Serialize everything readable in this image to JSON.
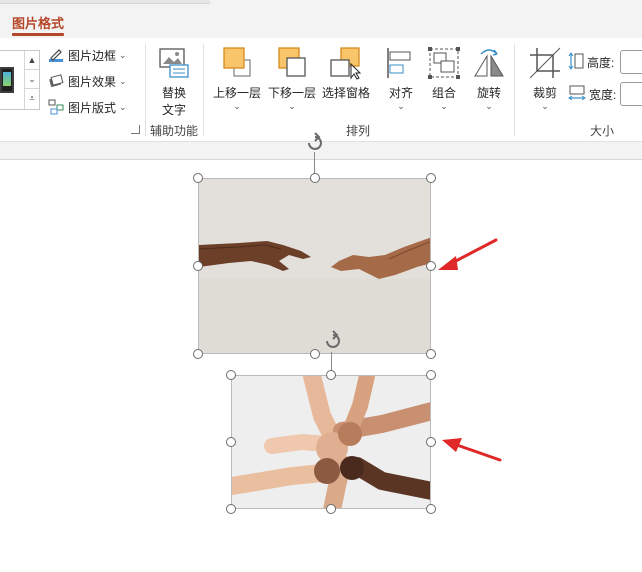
{
  "tab": {
    "label": "图片格式"
  },
  "ribbon": {
    "picture_styles": {
      "border_label": "图片边框",
      "effects_label": "图片效果",
      "layout_label": "图片版式"
    },
    "accessibility": {
      "alt_text_line1": "替换",
      "alt_text_line2": "文字",
      "group_label": "辅助功能"
    },
    "arrange": {
      "bring_forward": "上移一层",
      "send_backward": "下移一层",
      "selection_pane": "选择窗格",
      "align": "对齐",
      "group": "组合",
      "rotate": "旋转",
      "group_label": "排列"
    },
    "size": {
      "crop": "裁剪",
      "height_label": "高度:",
      "width_label": "宽度:",
      "group_label": "大小"
    }
  },
  "colors": {
    "accent": "#b7472a",
    "arrow": "#e02828",
    "icon_orange": "#f9c56b",
    "icon_orange_border": "#d58a1e"
  },
  "images": [
    {
      "subject": "two hands reaching toward each other"
    },
    {
      "subject": "interlocked arms forming a circle"
    }
  ]
}
